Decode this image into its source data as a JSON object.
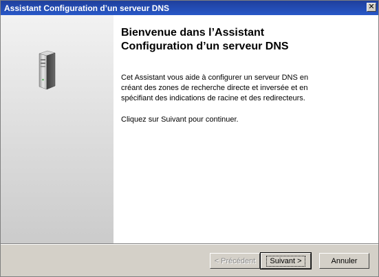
{
  "window": {
    "title": "Assistant Configuration d’un serveur DNS",
    "close_glyph": "✕"
  },
  "left_pane": {
    "icon": "server-tower-icon"
  },
  "main": {
    "heading": "Bienvenue dans l’Assistant\nConfiguration d’un serveur DNS",
    "paragraph1": "Cet Assistant vous aide à configurer un serveur DNS en\ncréant des zones de recherche directe et inversée et en\nspécifiant des indications de racine et des redirecteurs.",
    "paragraph2": "Cliquez sur Suivant pour continuer."
  },
  "footer": {
    "prev_label": "< Précédent",
    "next_label": "Suivant >",
    "cancel_label": "Annuler"
  }
}
